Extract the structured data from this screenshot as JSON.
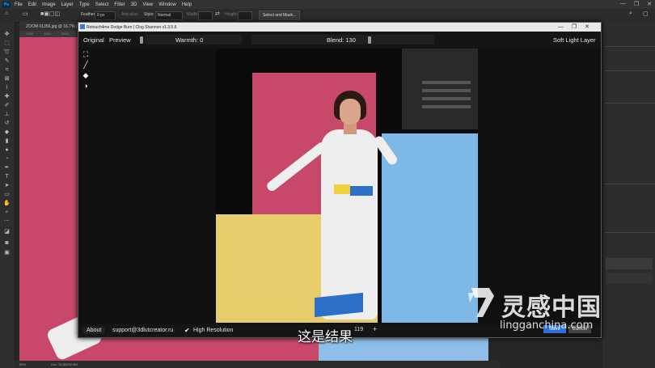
{
  "photoshop": {
    "logo": "Ps",
    "menu": [
      "File",
      "Edit",
      "Image",
      "Layer",
      "Type",
      "Select",
      "Filter",
      "3D",
      "View",
      "Window",
      "Help"
    ],
    "window_controls": [
      "—",
      "❐",
      "✕"
    ],
    "options": {
      "feather_label": "Feather:",
      "feather_value": "0 px",
      "antialias_label": "Anti-alias",
      "style_label": "Style:",
      "style_value": "Normal",
      "width_label": "Width:",
      "height_label": "Height:",
      "select_mask_label": "Select and Mask..."
    },
    "doc_tab": "ZOOM 01356.jpg @ 16.7% (Holl...",
    "ruler_ticks": [
      "1000",
      "1100",
      "1200"
    ],
    "status": {
      "zoom": "50%",
      "doc": "Doc: 32,8M/32.9M"
    }
  },
  "plugin": {
    "title": "Retouch4me Dodge Burn  |  Clog Shannon  v1.3.5.6",
    "top": {
      "original": "Original",
      "preview": "Preview",
      "warmth": "Warmth: 0",
      "blend": "Blend: 130",
      "soft_light": "Soft Light Layer"
    },
    "side_tools": [
      {
        "icon": "fit-screen-icon",
        "glyph": "⛶"
      },
      {
        "icon": "brush-icon",
        "glyph": "╱"
      },
      {
        "icon": "eraser-icon",
        "glyph": "◆"
      },
      {
        "icon": "contrast-icon",
        "glyph": "◑"
      }
    ],
    "bottom": {
      "about": "About",
      "support": "support@3dlutcreator.ru",
      "high_res_check": "✔",
      "high_res": "High Resolution",
      "zoom_value": "119",
      "zoom_plus": "+"
    },
    "ok_label": "Save",
    "cancel_label": "Cancel"
  },
  "subtitle": "这是结果",
  "watermark": {
    "text": "灵感中国",
    "url": "lingganchina.com"
  }
}
